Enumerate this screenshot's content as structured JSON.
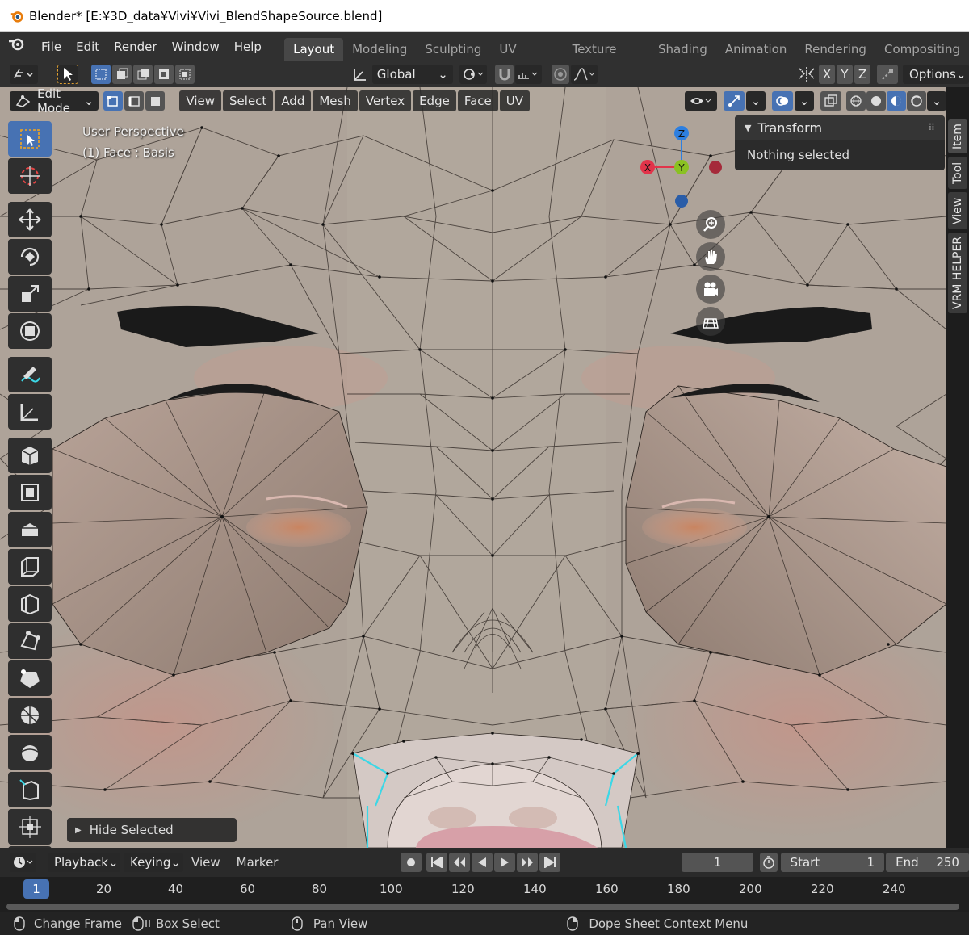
{
  "window": {
    "title": "Blender* [E:¥3D_data¥Vivi¥Vivi_BlendShapeSource.blend]"
  },
  "menubar": {
    "items": [
      "File",
      "Edit",
      "Render",
      "Window",
      "Help"
    ],
    "workspaces": [
      "Layout",
      "Modeling",
      "Sculpting",
      "UV Editing",
      "Texture Paint",
      "Shading",
      "Animation",
      "Rendering",
      "Compositing"
    ],
    "active_workspace": "Layout"
  },
  "tool_header": {
    "orientation": "Global",
    "axes": [
      "X",
      "Y",
      "Z"
    ],
    "options_label": "Options"
  },
  "viewport_header": {
    "mode": "Edit Mode",
    "menus": [
      "View",
      "Select",
      "Add",
      "Mesh",
      "Vertex",
      "Edge",
      "Face",
      "UV"
    ]
  },
  "viewport": {
    "perspective_label": "User Perspective",
    "object_label": "(1) Face : Basis",
    "gizmo_axes": {
      "x": "X",
      "y": "Y",
      "z": "Z"
    },
    "last_op_label": "Hide Selected"
  },
  "npanel": {
    "section_title": "Transform",
    "message": "Nothing selected",
    "tabs": [
      "Item",
      "Tool",
      "View",
      "VRM HELPER"
    ]
  },
  "timeline": {
    "menus": [
      "Playback",
      "Keying",
      "View",
      "Marker"
    ],
    "current_frame": "1",
    "start_label": "Start",
    "start_value": "1",
    "end_label": "End",
    "end_value": "250",
    "ruler_marks": [
      "20",
      "40",
      "60",
      "80",
      "100",
      "120",
      "140",
      "160",
      "180",
      "200",
      "220",
      "240"
    ]
  },
  "statusbar": {
    "left_click": "Change Frame",
    "drag": "Box Select",
    "middle": "Pan View",
    "right": "Dope Sheet Context Menu"
  },
  "colors": {
    "accent": "#4772b3",
    "axis_x": "#e2344a",
    "axis_y": "#8ac122",
    "axis_z": "#2d7fe0",
    "selected_edge": "#3cd7e6"
  }
}
